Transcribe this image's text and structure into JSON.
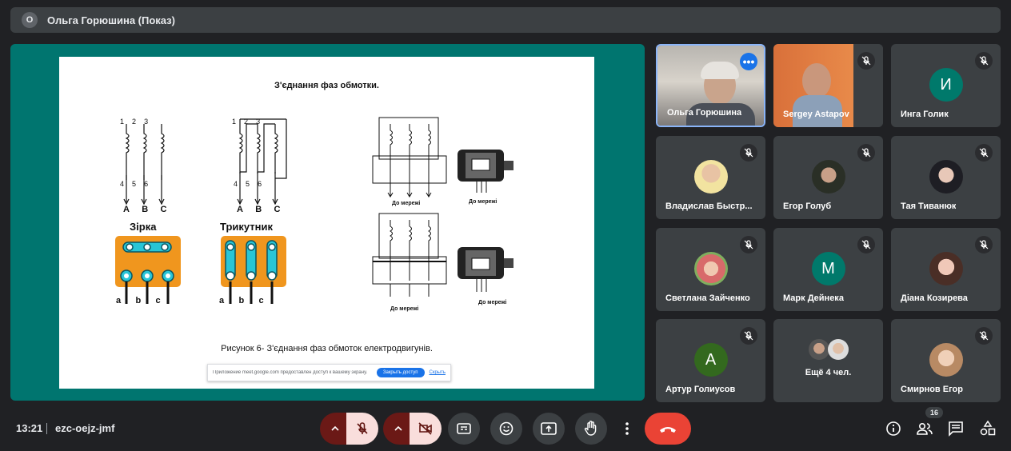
{
  "presenter_bar": {
    "badge": "О",
    "title": "Ольга Горюшина (Показ)"
  },
  "slide": {
    "heading": "З'єднання фаз обмотки.",
    "star_label": "Зірка",
    "delta_label": "Трикутник",
    "terminal_numbers_top": [
      "1",
      "2",
      "3"
    ],
    "terminal_numbers_bottom": [
      "4",
      "5",
      "6"
    ],
    "phase_letters": [
      "A",
      "B",
      "C"
    ],
    "box_letters": [
      "a",
      "b",
      "c"
    ],
    "network_label_1": "До мережі",
    "network_label_2": "До мережі",
    "network_label_3": "До мережі",
    "network_label_4": "До мережі",
    "caption": "Рисунок 6- З'єднання фаз обмоток електродвигунів.",
    "share_message": "Приложение meet.google.com предоставлен доступ к вашему экрану.",
    "stop_sharing": "Закрыть доступ",
    "hide": "Скрыть"
  },
  "participants": [
    {
      "name": "Ольга Горюшина",
      "type": "video",
      "active": true
    },
    {
      "name": "Sergey Astapov",
      "type": "video",
      "muted": true
    },
    {
      "name": "Инга Голик",
      "type": "initial",
      "initial": "И",
      "color": "#00796b",
      "muted": true
    },
    {
      "name": "Владислав Быстр...",
      "type": "photo",
      "muted": true
    },
    {
      "name": "Егор Голуб",
      "type": "photo",
      "muted": true
    },
    {
      "name": "Тая Тиванюк",
      "type": "photo",
      "muted": true
    },
    {
      "name": "Светлана Зайченко",
      "type": "photo",
      "muted": true
    },
    {
      "name": "Марк Дейнека",
      "type": "initial",
      "initial": "М",
      "color": "#00796b",
      "muted": true
    },
    {
      "name": "Діана Козирева",
      "type": "photo",
      "muted": true
    },
    {
      "name": "Артур Голиусов",
      "type": "initial",
      "initial": "А",
      "color": "#33691e",
      "muted": true
    },
    {
      "name": "Ещё 4 чел.",
      "type": "more"
    },
    {
      "name": "Смирнов Егор",
      "type": "photo",
      "muted": true
    }
  ],
  "bottom_bar": {
    "time": "13:21",
    "meeting_code": "ezc-oejz-jmf",
    "participant_count": "16"
  },
  "colors": {
    "stage": "#00756f",
    "accent": "#1a73e8",
    "hangup": "#ea4335"
  }
}
